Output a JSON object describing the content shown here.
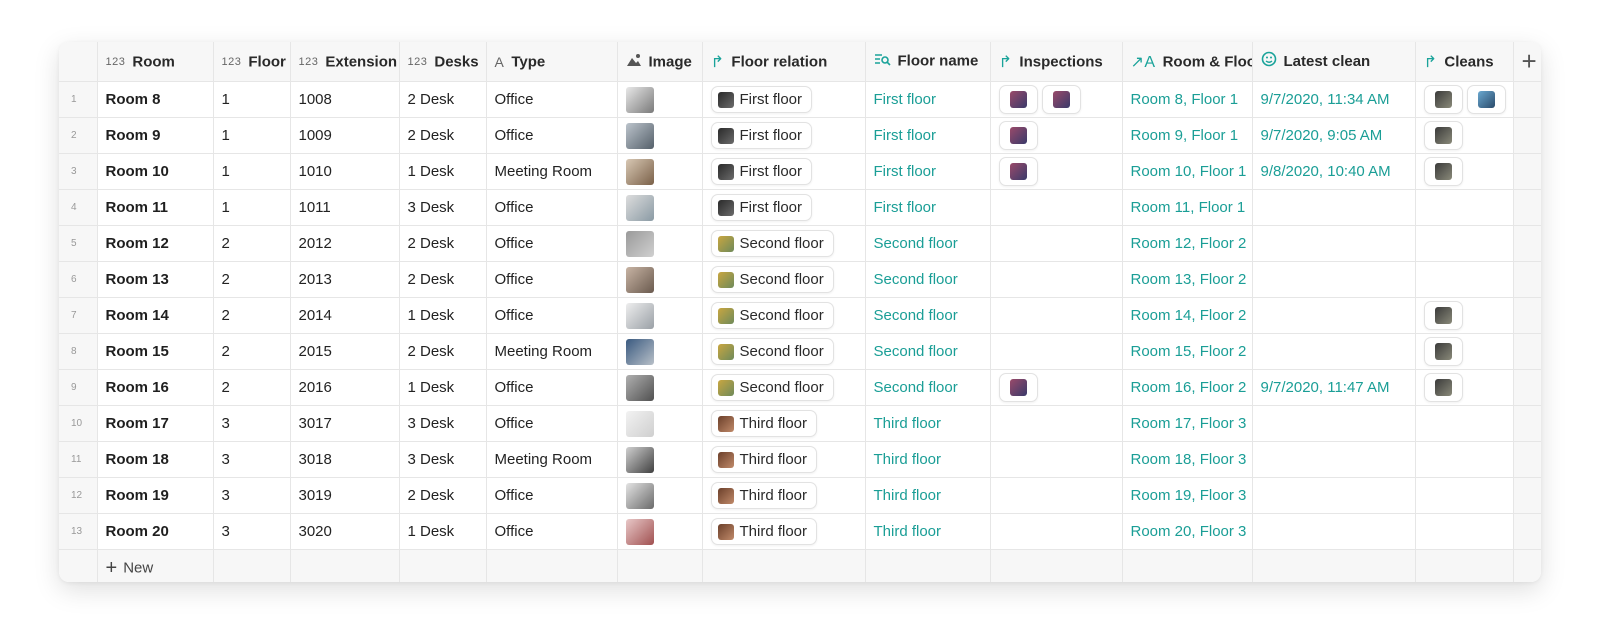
{
  "columns": [
    {
      "icon": "123",
      "label": "Room"
    },
    {
      "icon": "123",
      "label": "Floor"
    },
    {
      "icon": "123",
      "label": "Extension"
    },
    {
      "icon": "123",
      "label": "Desks"
    },
    {
      "icon": "A",
      "label": "Type"
    },
    {
      "icon": "",
      "label": "Image"
    },
    {
      "icon": "",
      "label": "Floor relation"
    },
    {
      "icon": "",
      "label": "Floor name"
    },
    {
      "icon": "",
      "label": "Inspections"
    },
    {
      "icon": "",
      "label": "Room & Floor"
    },
    {
      "icon": "",
      "label": "Latest clean"
    },
    {
      "icon": "",
      "label": "Cleans"
    }
  ],
  "rows": [
    {
      "num": "1",
      "room": "Room 8",
      "floor": "1",
      "extension": "1008",
      "desks": "2 Desk",
      "type": "Office",
      "floor_relation": "First floor",
      "floor_name": "First floor",
      "inspections": 2,
      "room_floor": "Room 8, Floor 1",
      "latest_clean": "9/7/2020, 11:34 AM",
      "cleans": 2
    },
    {
      "num": "2",
      "room": "Room 9",
      "floor": "1",
      "extension": "1009",
      "desks": "2 Desk",
      "type": "Office",
      "floor_relation": "First floor",
      "floor_name": "First floor",
      "inspections": 1,
      "room_floor": "Room 9, Floor 1",
      "latest_clean": "9/7/2020, 9:05 AM",
      "cleans": 1
    },
    {
      "num": "3",
      "room": "Room 10",
      "floor": "1",
      "extension": "1010",
      "desks": "1 Desk",
      "type": "Meeting Room",
      "floor_relation": "First floor",
      "floor_name": "First floor",
      "inspections": 1,
      "room_floor": "Room 10, Floor 1",
      "latest_clean": "9/8/2020, 10:40 AM",
      "cleans": 1
    },
    {
      "num": "4",
      "room": "Room 11",
      "floor": "1",
      "extension": "1011",
      "desks": "3 Desk",
      "type": "Office",
      "floor_relation": "First floor",
      "floor_name": "First floor",
      "inspections": 0,
      "room_floor": "Room 11, Floor 1",
      "latest_clean": "",
      "cleans": 0
    },
    {
      "num": "5",
      "room": "Room 12",
      "floor": "2",
      "extension": "2012",
      "desks": "2 Desk",
      "type": "Office",
      "floor_relation": "Second floor",
      "floor_name": "Second floor",
      "inspections": 0,
      "room_floor": "Room 12, Floor 2",
      "latest_clean": "",
      "cleans": 0
    },
    {
      "num": "6",
      "room": "Room 13",
      "floor": "2",
      "extension": "2013",
      "desks": "2 Desk",
      "type": "Office",
      "floor_relation": "Second floor",
      "floor_name": "Second floor",
      "inspections": 0,
      "room_floor": "Room 13, Floor 2",
      "latest_clean": "",
      "cleans": 0
    },
    {
      "num": "7",
      "room": "Room 14",
      "floor": "2",
      "extension": "2014",
      "desks": "1 Desk",
      "type": "Office",
      "floor_relation": "Second floor",
      "floor_name": "Second floor",
      "inspections": 0,
      "room_floor": "Room 14, Floor 2",
      "latest_clean": "",
      "cleans": 1
    },
    {
      "num": "8",
      "room": "Room 15",
      "floor": "2",
      "extension": "2015",
      "desks": "2 Desk",
      "type": "Meeting Room",
      "floor_relation": "Second floor",
      "floor_name": "Second floor",
      "inspections": 0,
      "room_floor": "Room 15, Floor 2",
      "latest_clean": "",
      "cleans": 1
    },
    {
      "num": "9",
      "room": "Room 16",
      "floor": "2",
      "extension": "2016",
      "desks": "1 Desk",
      "type": "Office",
      "floor_relation": "Second floor",
      "floor_name": "Second floor",
      "inspections": 1,
      "room_floor": "Room 16, Floor 2",
      "latest_clean": "9/7/2020, 11:47 AM",
      "cleans": 1
    },
    {
      "num": "10",
      "room": "Room 17",
      "floor": "3",
      "extension": "3017",
      "desks": "3 Desk",
      "type": "Office",
      "floor_relation": "Third floor",
      "floor_name": "Third floor",
      "inspections": 0,
      "room_floor": "Room 17, Floor 3",
      "latest_clean": "",
      "cleans": 0
    },
    {
      "num": "11",
      "room": "Room 18",
      "floor": "3",
      "extension": "3018",
      "desks": "3 Desk",
      "type": "Meeting Room",
      "floor_relation": "Third floor",
      "floor_name": "Third floor",
      "inspections": 0,
      "room_floor": "Room 18, Floor 3",
      "latest_clean": "",
      "cleans": 0
    },
    {
      "num": "12",
      "room": "Room 19",
      "floor": "3",
      "extension": "3019",
      "desks": "2 Desk",
      "type": "Office",
      "floor_relation": "Third floor",
      "floor_name": "Third floor",
      "inspections": 0,
      "room_floor": "Room 19, Floor 3",
      "latest_clean": "",
      "cleans": 0
    },
    {
      "num": "13",
      "room": "Room 20",
      "floor": "3",
      "extension": "3020",
      "desks": "1 Desk",
      "type": "Office",
      "floor_relation": "Third floor",
      "floor_name": "Third floor",
      "inspections": 0,
      "room_floor": "Room 20, Floor 3",
      "latest_clean": "",
      "cleans": 0
    }
  ],
  "new_row_label": "New",
  "colors": {
    "accent": "#1a9e96",
    "header_bg": "#f7f7f7",
    "border": "#e6e6e6"
  }
}
